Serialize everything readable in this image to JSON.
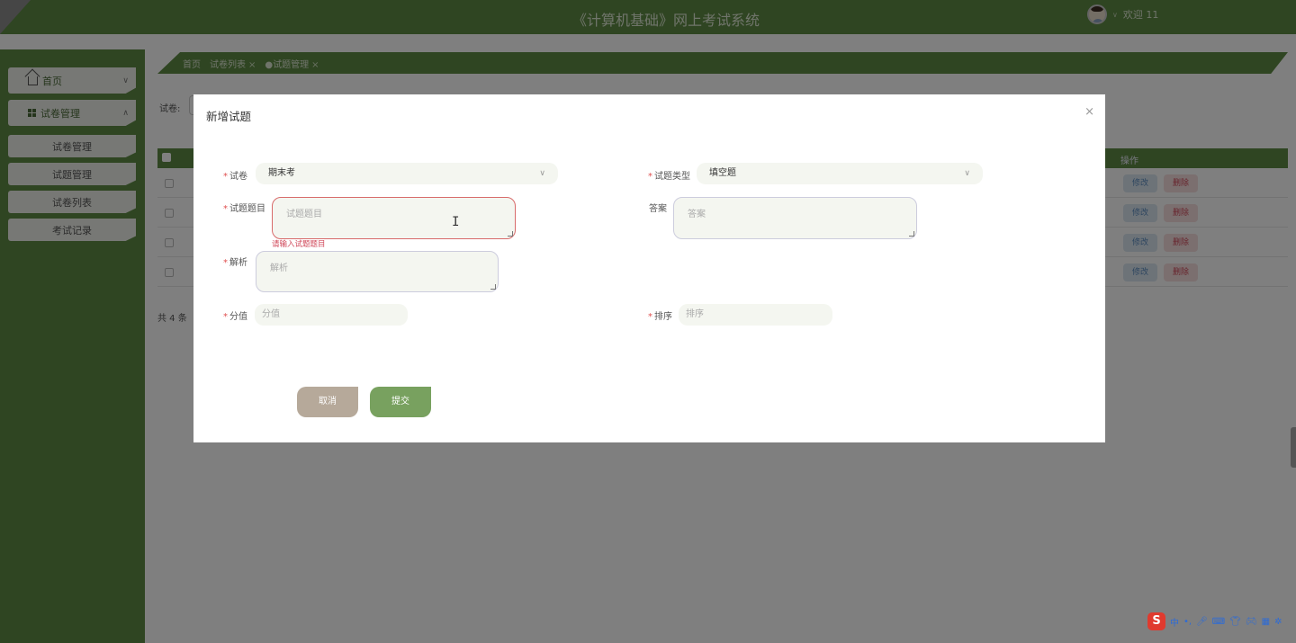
{
  "header": {
    "title": "《计算机基础》网上考试系统",
    "welcome": "欢迎 11"
  },
  "sidebar": {
    "items": [
      {
        "label": "首页"
      },
      {
        "label": "试卷管理"
      },
      {
        "label": "试卷管理"
      },
      {
        "label": "试题管理"
      },
      {
        "label": "试卷列表"
      },
      {
        "label": "考试记录"
      }
    ]
  },
  "tabs": [
    {
      "label": "首页"
    },
    {
      "label": "试卷列表"
    },
    {
      "label": "●试题管理"
    }
  ],
  "filter": {
    "label": "试卷:"
  },
  "table": {
    "op_header": "操作",
    "edit_label": "修改",
    "delete_label": "删除",
    "row_count": 4,
    "total": "共 4 条"
  },
  "dialog": {
    "title": "新增试题",
    "close": "×",
    "fields": {
      "paper": {
        "label": "试卷",
        "value": "期末考"
      },
      "type": {
        "label": "试题类型",
        "value": "填空题"
      },
      "question": {
        "label": "试题题目",
        "placeholder": "试题题目",
        "error": "请输入试题题目"
      },
      "answer": {
        "label": "答案",
        "placeholder": "答案"
      },
      "analysis": {
        "label": "解析",
        "placeholder": "解析"
      },
      "score": {
        "label": "分值",
        "placeholder": "分值"
      },
      "order": {
        "label": "排序",
        "placeholder": "排序"
      }
    },
    "cancel": "取消",
    "submit": "提交"
  },
  "ime": {
    "logo": "S",
    "mode": "中"
  },
  "colors": {
    "primary": "#5f8a45",
    "submit": "#78a15f",
    "cancel": "#b6a99a",
    "error": "#d0485a"
  }
}
